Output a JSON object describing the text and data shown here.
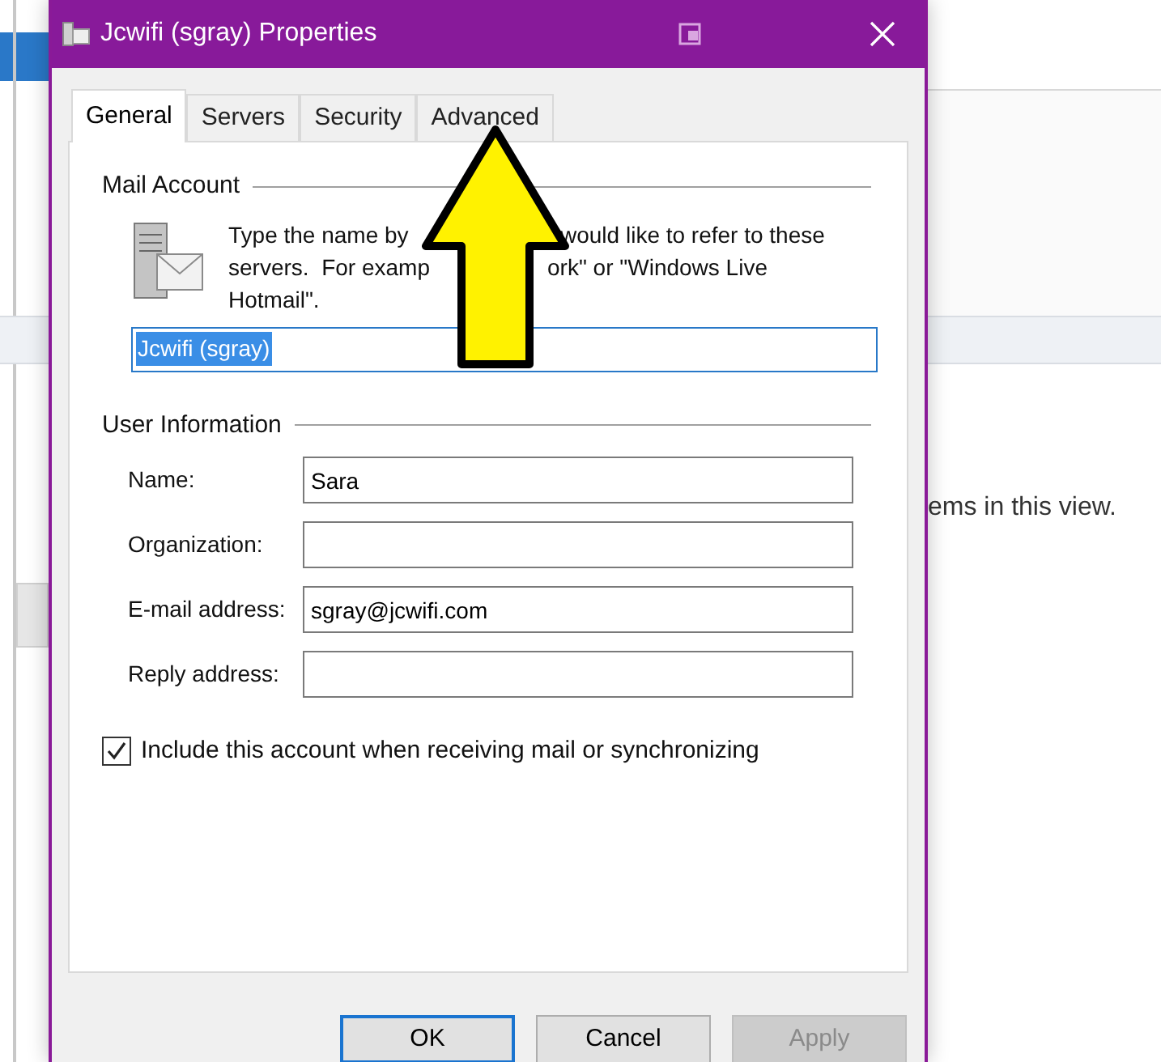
{
  "window": {
    "title": "Jcwifi (sgray) Properties"
  },
  "tabs": [
    {
      "label": "General",
      "selected": true
    },
    {
      "label": "Servers",
      "selected": false
    },
    {
      "label": "Security",
      "selected": false
    },
    {
      "label": "Advanced",
      "selected": false
    }
  ],
  "mail_account": {
    "heading": "Mail Account",
    "description_lines": [
      [
        "Type the name by",
        "would like to refer to these"
      ],
      [
        "servers.  For examp",
        "ork\" or \"Windows Live"
      ],
      [
        "Hotmail\"."
      ]
    ],
    "account_name": {
      "value": "Jcwifi (sgray)",
      "text_selected": true
    }
  },
  "user_information": {
    "heading": "User Information",
    "fields": [
      {
        "label": "Name:",
        "value": "Sara"
      },
      {
        "label": "Organization:"
      },
      {
        "label": "E-mail address:",
        "value": "sgray@jcwifi.com"
      },
      {
        "label": "Reply address:"
      }
    ]
  },
  "include_account": {
    "label": "Include this account when receiving mail or synchronizing",
    "checked": true
  },
  "buttons": [
    {
      "label": "OK",
      "default": true,
      "disabled": false
    },
    {
      "label": "Cancel",
      "default": false,
      "disabled": false
    },
    {
      "label": "Apply",
      "default": false,
      "disabled": true
    }
  ],
  "background": {
    "text": "ems in this view."
  }
}
